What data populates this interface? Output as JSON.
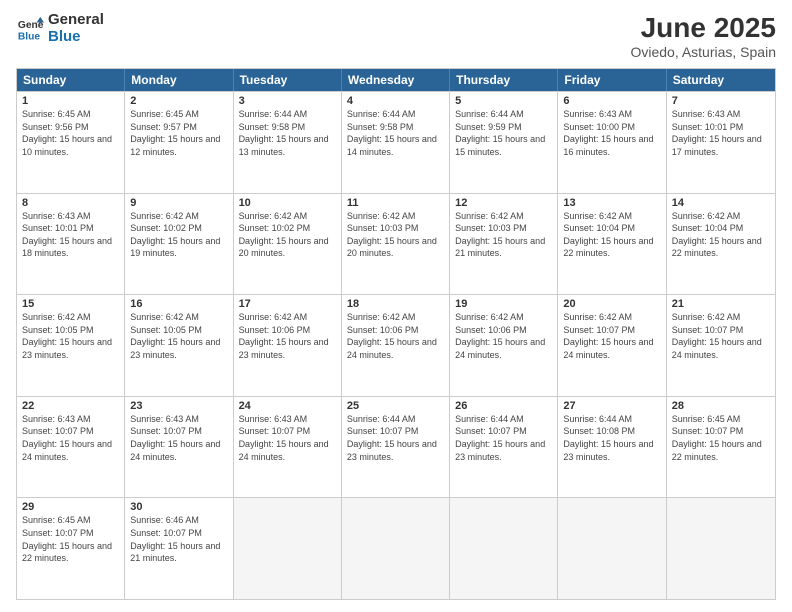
{
  "logo": {
    "line1": "General",
    "line2": "Blue"
  },
  "title": "June 2025",
  "subtitle": "Oviedo, Asturias, Spain",
  "headers": [
    "Sunday",
    "Monday",
    "Tuesday",
    "Wednesday",
    "Thursday",
    "Friday",
    "Saturday"
  ],
  "weeks": [
    [
      {
        "day": "1",
        "sunrise": "6:45 AM",
        "sunset": "9:56 PM",
        "daylight": "15 hours and 10 minutes."
      },
      {
        "day": "2",
        "sunrise": "6:45 AM",
        "sunset": "9:57 PM",
        "daylight": "15 hours and 12 minutes."
      },
      {
        "day": "3",
        "sunrise": "6:44 AM",
        "sunset": "9:58 PM",
        "daylight": "15 hours and 13 minutes."
      },
      {
        "day": "4",
        "sunrise": "6:44 AM",
        "sunset": "9:58 PM",
        "daylight": "15 hours and 14 minutes."
      },
      {
        "day": "5",
        "sunrise": "6:44 AM",
        "sunset": "9:59 PM",
        "daylight": "15 hours and 15 minutes."
      },
      {
        "day": "6",
        "sunrise": "6:43 AM",
        "sunset": "10:00 PM",
        "daylight": "15 hours and 16 minutes."
      },
      {
        "day": "7",
        "sunrise": "6:43 AM",
        "sunset": "10:01 PM",
        "daylight": "15 hours and 17 minutes."
      }
    ],
    [
      {
        "day": "8",
        "sunrise": "6:43 AM",
        "sunset": "10:01 PM",
        "daylight": "15 hours and 18 minutes."
      },
      {
        "day": "9",
        "sunrise": "6:42 AM",
        "sunset": "10:02 PM",
        "daylight": "15 hours and 19 minutes."
      },
      {
        "day": "10",
        "sunrise": "6:42 AM",
        "sunset": "10:02 PM",
        "daylight": "15 hours and 20 minutes."
      },
      {
        "day": "11",
        "sunrise": "6:42 AM",
        "sunset": "10:03 PM",
        "daylight": "15 hours and 20 minutes."
      },
      {
        "day": "12",
        "sunrise": "6:42 AM",
        "sunset": "10:03 PM",
        "daylight": "15 hours and 21 minutes."
      },
      {
        "day": "13",
        "sunrise": "6:42 AM",
        "sunset": "10:04 PM",
        "daylight": "15 hours and 22 minutes."
      },
      {
        "day": "14",
        "sunrise": "6:42 AM",
        "sunset": "10:04 PM",
        "daylight": "15 hours and 22 minutes."
      }
    ],
    [
      {
        "day": "15",
        "sunrise": "6:42 AM",
        "sunset": "10:05 PM",
        "daylight": "15 hours and 23 minutes."
      },
      {
        "day": "16",
        "sunrise": "6:42 AM",
        "sunset": "10:05 PM",
        "daylight": "15 hours and 23 minutes."
      },
      {
        "day": "17",
        "sunrise": "6:42 AM",
        "sunset": "10:06 PM",
        "daylight": "15 hours and 23 minutes."
      },
      {
        "day": "18",
        "sunrise": "6:42 AM",
        "sunset": "10:06 PM",
        "daylight": "15 hours and 24 minutes."
      },
      {
        "day": "19",
        "sunrise": "6:42 AM",
        "sunset": "10:06 PM",
        "daylight": "15 hours and 24 minutes."
      },
      {
        "day": "20",
        "sunrise": "6:42 AM",
        "sunset": "10:07 PM",
        "daylight": "15 hours and 24 minutes."
      },
      {
        "day": "21",
        "sunrise": "6:42 AM",
        "sunset": "10:07 PM",
        "daylight": "15 hours and 24 minutes."
      }
    ],
    [
      {
        "day": "22",
        "sunrise": "6:43 AM",
        "sunset": "10:07 PM",
        "daylight": "15 hours and 24 minutes."
      },
      {
        "day": "23",
        "sunrise": "6:43 AM",
        "sunset": "10:07 PM",
        "daylight": "15 hours and 24 minutes."
      },
      {
        "day": "24",
        "sunrise": "6:43 AM",
        "sunset": "10:07 PM",
        "daylight": "15 hours and 24 minutes."
      },
      {
        "day": "25",
        "sunrise": "6:44 AM",
        "sunset": "10:07 PM",
        "daylight": "15 hours and 23 minutes."
      },
      {
        "day": "26",
        "sunrise": "6:44 AM",
        "sunset": "10:07 PM",
        "daylight": "15 hours and 23 minutes."
      },
      {
        "day": "27",
        "sunrise": "6:44 AM",
        "sunset": "10:08 PM",
        "daylight": "15 hours and 23 minutes."
      },
      {
        "day": "28",
        "sunrise": "6:45 AM",
        "sunset": "10:07 PM",
        "daylight": "15 hours and 22 minutes."
      }
    ],
    [
      {
        "day": "29",
        "sunrise": "6:45 AM",
        "sunset": "10:07 PM",
        "daylight": "15 hours and 22 minutes."
      },
      {
        "day": "30",
        "sunrise": "6:46 AM",
        "sunset": "10:07 PM",
        "daylight": "15 hours and 21 minutes."
      },
      null,
      null,
      null,
      null,
      null
    ]
  ]
}
